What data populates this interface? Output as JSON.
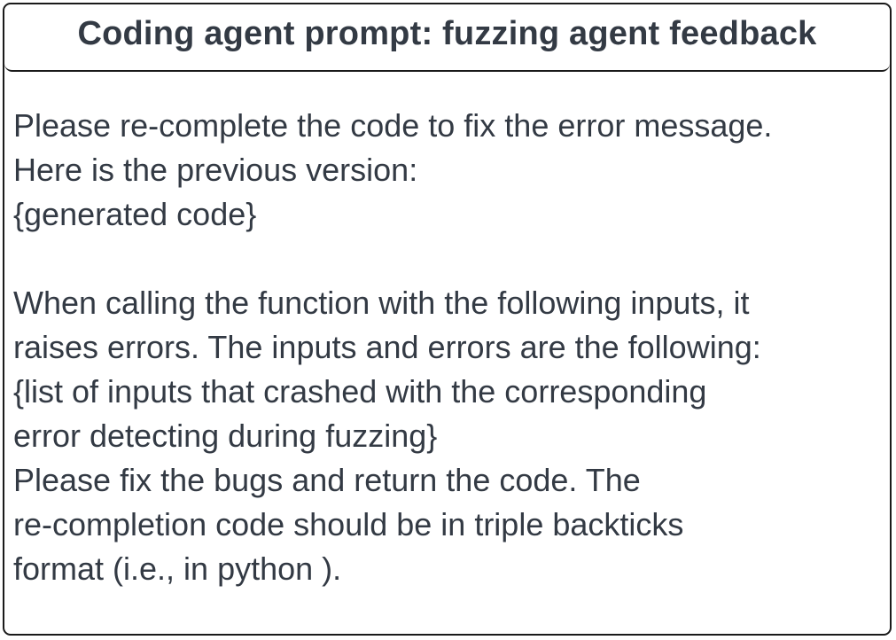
{
  "title": "Coding agent prompt: fuzzing agent feedback",
  "body_lines": [
    "Please re-complete the code to fix the error message.",
    "Here is the previous version:",
    "{generated code}",
    "",
    "When calling the function with the following inputs, it",
    "raises errors. The inputs and errors are the following:",
    "{list of inputs that crashed with the corresponding",
    "error detecting during fuzzing}",
    "Please fix the bugs and return the code. The",
    "re-completion code should be in triple backticks",
    "format (i.e., in python )."
  ]
}
